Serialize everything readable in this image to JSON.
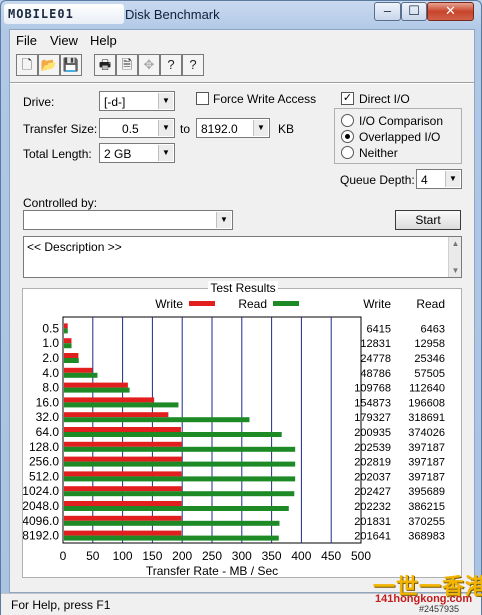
{
  "window": {
    "logo_text": "MOBILE01",
    "title": "Disk Benchmark",
    "min_glyph": "–",
    "max_glyph": "☐",
    "close_glyph": "✕"
  },
  "menu": [
    "File",
    "View",
    "Help"
  ],
  "toolbar": {
    "new": "🗋",
    "open": "📂",
    "save": "💾",
    "print": "🖶",
    "preview": "🗎",
    "move": "✥",
    "help": "?",
    "context_help": "?"
  },
  "settings": {
    "drive_label": "Drive:",
    "drive_value": "[-d-]",
    "force_write_label": "Force Write Access",
    "force_write_checked": false,
    "direct_io_label": "Direct I/O",
    "direct_io_checked": true,
    "transfer_size_label": "Transfer Size:",
    "transfer_from": "0.5",
    "to_label": "to",
    "transfer_to": "8192.0",
    "unit_label": "KB",
    "total_length_label": "Total Length:",
    "total_length_value": "2 GB",
    "io_options": [
      "I/O Comparison",
      "Overlapped I/O",
      "Neither"
    ],
    "io_selected": "Overlapped I/O",
    "queue_depth_label": "Queue Depth:",
    "queue_depth_value": "4",
    "controlled_by_label": "Controlled by:",
    "controlled_by_value": "",
    "start_label": "Start",
    "description_text": "<< Description >>"
  },
  "chart_data": {
    "type": "bar",
    "title": "Test Results",
    "legend": [
      "Write",
      "Read"
    ],
    "colors": {
      "write": "#e11f1f",
      "read": "#1d8a26"
    },
    "categories": [
      "0.5",
      "1.0",
      "2.0",
      "4.0",
      "8.0",
      "16.0",
      "32.0",
      "64.0",
      "128.0",
      "256.0",
      "512.0",
      "1024.0",
      "2048.0",
      "4096.0",
      "8192.0"
    ],
    "series": [
      {
        "name": "Write",
        "values": [
          6415,
          12831,
          24778,
          48786,
          109768,
          154873,
          179327,
          200935,
          202539,
          202819,
          202037,
          202427,
          202232,
          201831,
          201641
        ]
      },
      {
        "name": "Read",
        "values": [
          6463,
          12958,
          25346,
          57505,
          112640,
          196608,
          318691,
          374026,
          397187,
          397187,
          397187,
          395689,
          386215,
          370255,
          368983
        ]
      }
    ],
    "value_headers": [
      "Write",
      "Read"
    ],
    "xlabel": "Transfer Rate - MB / Sec",
    "xticks": [
      0,
      50,
      100,
      150,
      200,
      250,
      300,
      350,
      400,
      450,
      500
    ],
    "xlim": [
      0,
      500
    ],
    "value_unit_divisor": 1024,
    "orientation": "horizontal",
    "grid": true
  },
  "status": {
    "text": "For Help, press F1"
  },
  "watermark": {
    "big": "一世一香港",
    "url": "141hongkong.com",
    "id": "#2457935"
  }
}
